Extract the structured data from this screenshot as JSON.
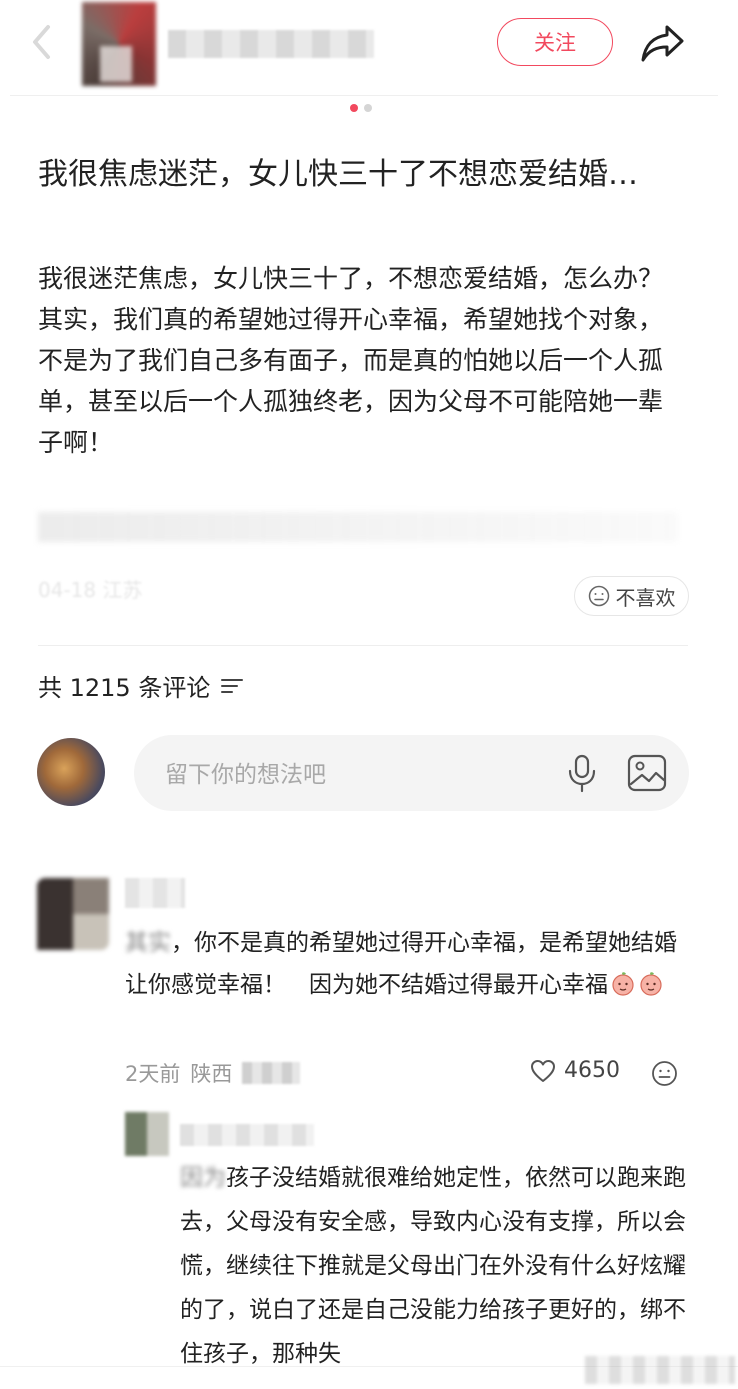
{
  "header": {
    "follow_label": "关注",
    "icons": [
      "back-icon",
      "share-icon"
    ],
    "accent_color": "#f2495e"
  },
  "carousel": {
    "current": 1,
    "total": 2
  },
  "post": {
    "title": "我很焦虑迷茫，女儿快三十了不想恋爱结婚…",
    "body_lines": [
      "我很迷茫焦虑，女儿快三十了，不想恋爱结婚，怎么办？",
      "其实，我们真的希望她过得开心幸福，希望她找个对象，不是为了我们自己多有面子，而是真的怕她以后一个人孤单，甚至以后一个人孤独终老，因为父母不可能陪她一辈子啊！"
    ],
    "meta": "04-18 江苏",
    "dislike_label": "不喜欢"
  },
  "comments_section": {
    "count_label": "共 1215 条评论",
    "input_placeholder": "留下你的想法吧"
  },
  "comments": [
    {
      "text_lead": "其实",
      "text": "，你不是真的希望她过得开心幸福，是希望她结婚让你感觉幸福！　因为她不结婚过得最开心幸福",
      "time": "2天前",
      "location": "陕西",
      "likes": "4650"
    }
  ],
  "replies": [
    {
      "text_lead": "因为",
      "text": "孩子没结婚就很难给她定性，依然可以跑来跑去，父母没有安全感，导致内心没有支撑，所以会慌，继续往下推就是父母出门在外没有什么好炫耀的了，说白了还是自己没能力给孩子更好的，绑不住孩子，那种失"
    }
  ]
}
